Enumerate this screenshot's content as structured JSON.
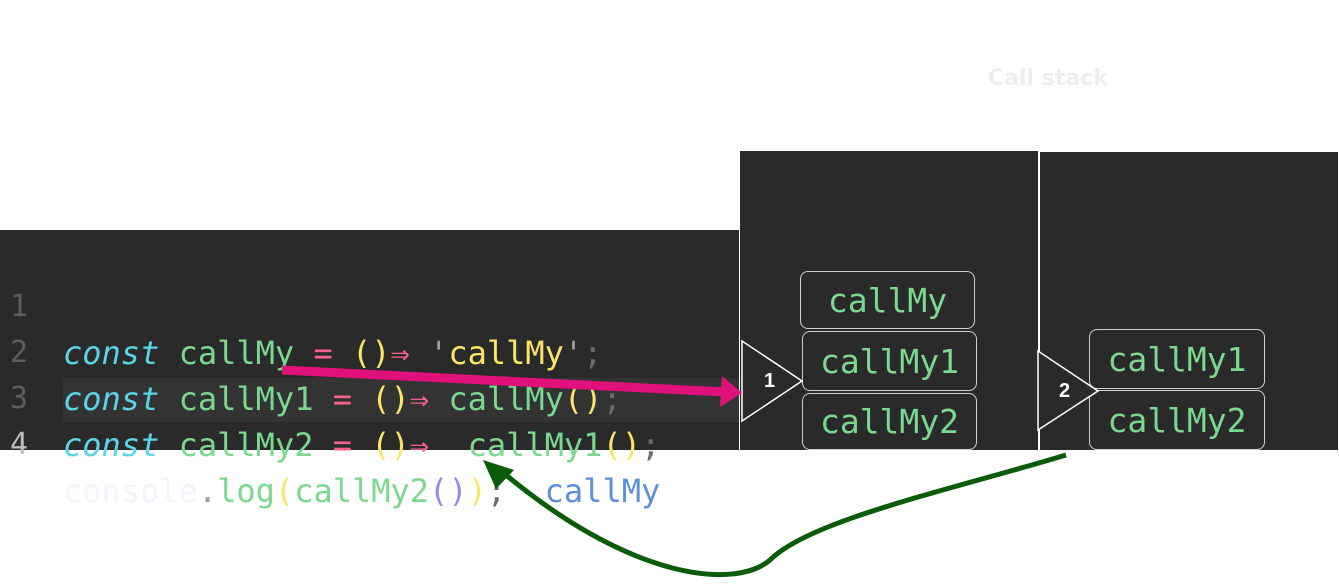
{
  "title": "Call stack",
  "editor": {
    "lines": [
      {
        "num": "1",
        "kw": "const",
        "name": "callMy",
        "eq": "=",
        "parens": "()",
        "arrow": "⇒",
        "q1": "'",
        "str": "callMy",
        "q2": "'",
        "semi": ";"
      },
      {
        "num": "2",
        "kw": "const",
        "name": "callMy1",
        "eq": "=",
        "parens": "()",
        "arrow": "⇒",
        "call": "callMy",
        "callparens": "()",
        "semi": ";"
      },
      {
        "num": "3",
        "kw": "const",
        "name": "callMy2",
        "eq": "=",
        "parens": "()",
        "arrow": "⇒",
        "call": "callMy1",
        "callparens": "()",
        "semi": ";"
      },
      {
        "num": "4",
        "obj": "console",
        "dot": ".",
        "fn": "log",
        "open": "(",
        "arg": "callMy2",
        "argparens": "()",
        "close": ")",
        "semi": ";",
        "inline_result": "callMy"
      }
    ]
  },
  "stacks": [
    {
      "step": "1",
      "frames": [
        "callMy",
        "callMy1",
        "callMy2"
      ]
    },
    {
      "step": "2",
      "frames": [
        "callMy1",
        "callMy2"
      ]
    }
  ],
  "colors": {
    "editor_bg": "#2a2a2a",
    "forward_arrow": "#e0117a",
    "return_arrow": "#0a5c0a"
  }
}
